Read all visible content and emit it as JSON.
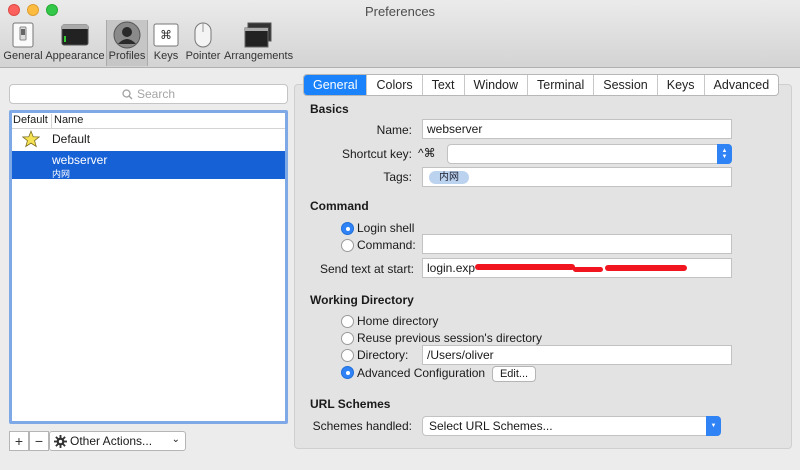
{
  "window": {
    "title": "Preferences"
  },
  "toolbar": {
    "items": [
      {
        "label": "General",
        "icon": "switch-icon"
      },
      {
        "label": "Appearance",
        "icon": "monitor-icon"
      },
      {
        "label": "Profiles",
        "icon": "person-icon"
      },
      {
        "label": "Keys",
        "icon": "command-key-icon"
      },
      {
        "label": "Pointer",
        "icon": "mouse-icon"
      },
      {
        "label": "Arrangements",
        "icon": "windows-icon"
      }
    ],
    "active": "Profiles"
  },
  "profiles": {
    "search_placeholder": "Search",
    "headers": {
      "default": "Default",
      "name": "Name"
    },
    "rows": [
      {
        "name": "Default",
        "tag": "",
        "is_default": true
      },
      {
        "name": "webserver",
        "tag": "内网",
        "is_default": false
      }
    ],
    "selected": "webserver",
    "add_label": "+",
    "remove_label": "−",
    "other_actions_label": "Other Actions..."
  },
  "tabs": [
    "General",
    "Colors",
    "Text",
    "Window",
    "Terminal",
    "Session",
    "Keys",
    "Advanced"
  ],
  "active_tab": "General",
  "basics": {
    "section": "Basics",
    "name_label": "Name:",
    "name_value": "webserver",
    "shortcut_label": "Shortcut key:",
    "shortcut_prefix": "^⌘",
    "shortcut_value": "",
    "tags_label": "Tags:",
    "tag_value": "内网"
  },
  "command": {
    "section": "Command",
    "login_shell_label": "Login shell",
    "command_label": "Command:",
    "command_value": "",
    "send_text_label": "Send text at start:",
    "send_text_value": "login.exp",
    "selected": "Login shell"
  },
  "working_directory": {
    "section": "Working Directory",
    "home_label": "Home directory",
    "reuse_label": "Reuse previous session's directory",
    "directory_label": "Directory:",
    "directory_value": "/Users/oliver",
    "advanced_label": "Advanced Configuration",
    "edit_label": "Edit...",
    "selected": "Advanced Configuration"
  },
  "url_schemes": {
    "section": "URL Schemes",
    "handled_label": "Schemes handled:",
    "select_value": "Select URL Schemes..."
  },
  "colors": {
    "accent": "#1a82fb",
    "selection": "#1761d7",
    "redaction": "#f0151f"
  }
}
